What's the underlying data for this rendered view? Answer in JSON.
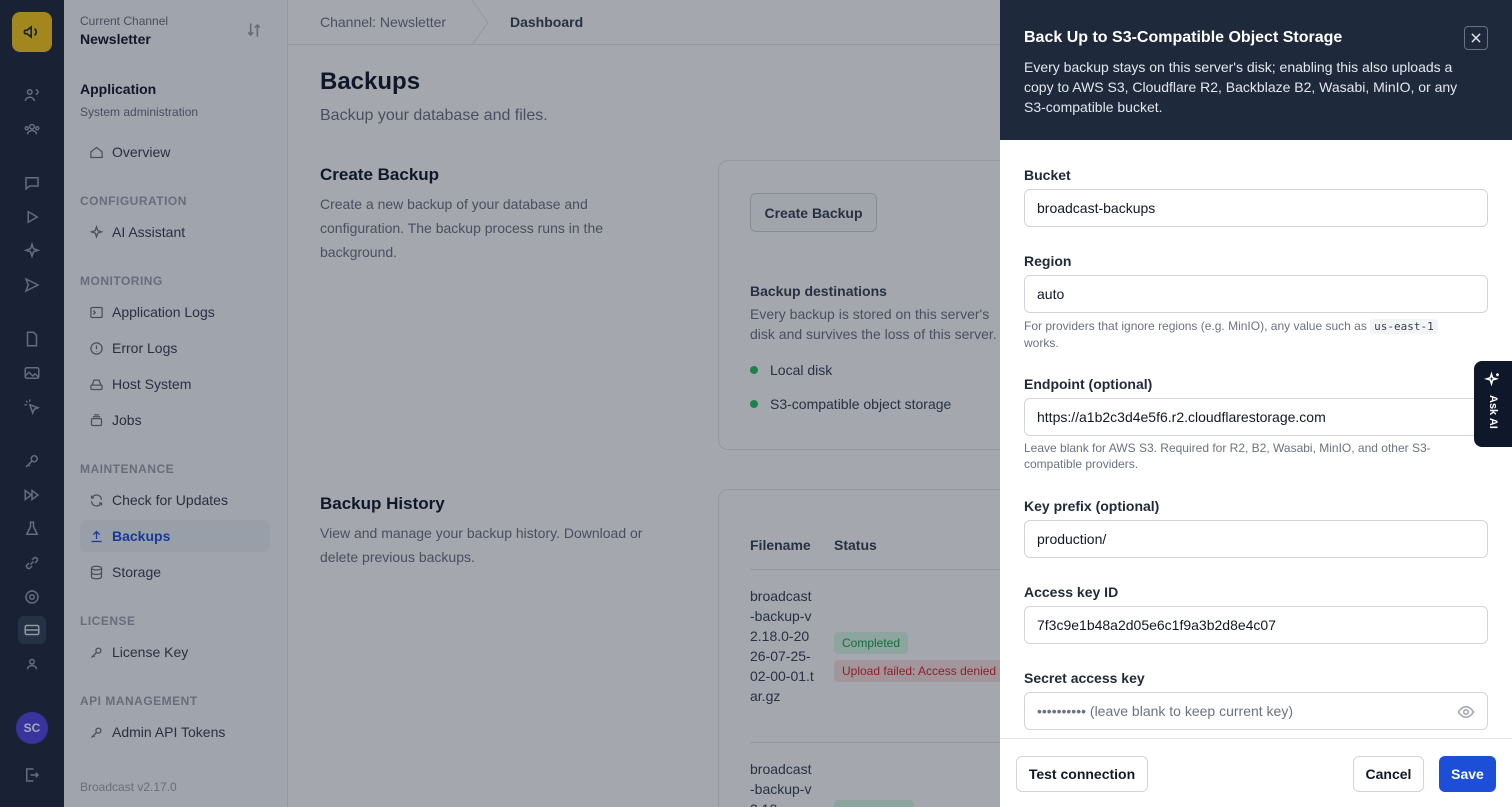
{
  "channel": {
    "caption": "Current Channel",
    "name": "Newsletter"
  },
  "sidebar": {
    "app_title": "Application",
    "app_subtitle": "System administration",
    "overview": "Overview",
    "sections": {
      "configuration": "CONFIGURATION",
      "monitoring": "MONITORING",
      "maintenance": "MAINTENANCE",
      "license": "LICENSE",
      "api_management": "API MANAGEMENT"
    },
    "items": {
      "ai_assistant": "AI Assistant",
      "application_logs": "Application Logs",
      "error_logs": "Error Logs",
      "host_system": "Host System",
      "jobs": "Jobs",
      "check_updates": "Check for Updates",
      "backups": "Backups",
      "storage": "Storage",
      "license_key": "License Key",
      "admin_api_tokens": "Admin API Tokens"
    },
    "version": "Broadcast v2.17.0"
  },
  "user": {
    "initials": "SC"
  },
  "breadcrumb": {
    "channel": "Channel: Newsletter",
    "current": "Dashboard"
  },
  "page": {
    "title": "Backups",
    "subtitle": "Backup your database and files."
  },
  "create_backup": {
    "heading": "Create Backup",
    "description": "Create a new backup of your database and configuration. The backup process runs in the background.",
    "button": "Create Backup",
    "destinations_title": "Backup destinations",
    "destinations_desc": "Every backup is stored on this server's disk and survives the loss of this server.",
    "destinations": [
      "Local disk",
      "S3-compatible object storage"
    ]
  },
  "history": {
    "heading": "Backup History",
    "description": "View and manage your backup history. Download or delete previous backups.",
    "columns": [
      "Filename",
      "Status"
    ],
    "rows": [
      {
        "filename": "broadcast-backup-v2.18.0-2026-07-25-02-00-01.tar.gz",
        "status": "Completed",
        "upload": "Upload failed: Access denied"
      },
      {
        "filename": "broadcast-backup-v2.18",
        "status": "Completed",
        "upload": ""
      }
    ]
  },
  "drawer": {
    "title": "Back Up to S3-Compatible Object Storage",
    "description": "Every backup stays on this server's disk; enabling this also uploads a copy to AWS S3, Cloudflare R2, Backblaze B2, Wasabi, MinIO, or any S3-compatible bucket.",
    "fields": {
      "bucket": {
        "label": "Bucket",
        "value": "broadcast-backups"
      },
      "region": {
        "label": "Region",
        "value": "auto",
        "help_pre": "For providers that ignore regions (e.g. MinIO), any value such as",
        "help_code": "us-east-1",
        "help_post": "works."
      },
      "endpoint": {
        "label": "Endpoint (optional)",
        "value": "https://a1b2c3d4e5f6.r2.cloudflarestorage.com",
        "help": "Leave blank for AWS S3. Required for R2, B2, Wasabi, MinIO, and other S3-compatible providers."
      },
      "prefix": {
        "label": "Key prefix (optional)",
        "value": "production/"
      },
      "access_key": {
        "label": "Access key ID",
        "value": "7f3c9e1b48a2d05e6c1f9a3b2d8e4c07"
      },
      "secret": {
        "label": "Secret access key",
        "placeholder": "•••••••••• (leave blank to keep current key)"
      }
    },
    "buttons": {
      "test": "Test connection",
      "cancel": "Cancel",
      "save": "Save"
    }
  },
  "ask_ai": "Ask AI"
}
